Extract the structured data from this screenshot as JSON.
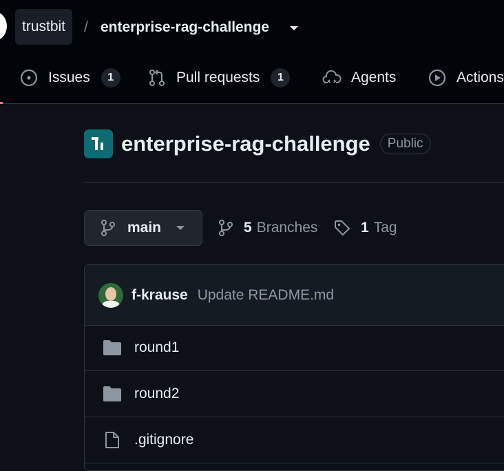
{
  "header": {
    "owner": "trustbit",
    "separator": "/",
    "repo": "enterprise-rag-challenge"
  },
  "tabs": [
    {
      "label": "Issues",
      "count": "1",
      "icon": "issue-opened-icon"
    },
    {
      "label": "Pull requests",
      "count": "1",
      "icon": "git-pull-request-icon"
    },
    {
      "label": "Agents",
      "icon": "agents-cloud-icon"
    },
    {
      "label": "Actions",
      "icon": "play-icon"
    }
  ],
  "repo": {
    "name": "enterprise-rag-challenge",
    "visibility": "Public"
  },
  "branch": {
    "current": "main",
    "branches_count": "5",
    "branches_label": "Branches",
    "tags_count": "1",
    "tags_label": "Tag"
  },
  "commit": {
    "author": "f-krause",
    "message": "Update README.md"
  },
  "files": [
    {
      "name": "round1",
      "type": "folder"
    },
    {
      "name": "round2",
      "type": "folder"
    },
    {
      "name": ".gitignore",
      "type": "file"
    }
  ],
  "colors": {
    "background": "#0d1117",
    "header_bg": "#010409",
    "text": "#e6edf3",
    "muted": "#8d96a0",
    "border": "#30363d",
    "repo_logo": "#0c6b73",
    "accent": "#f78166"
  }
}
